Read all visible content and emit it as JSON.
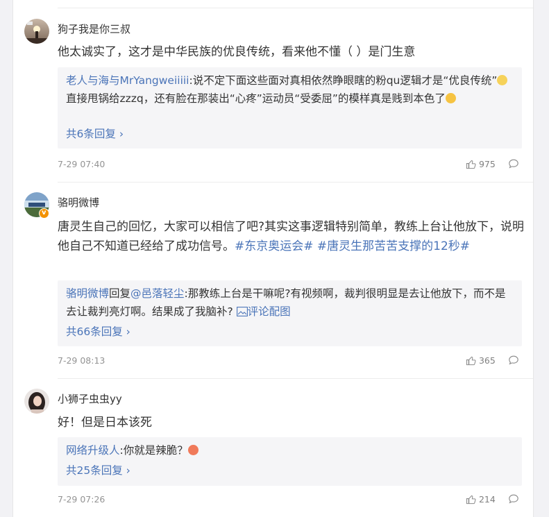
{
  "comments": [
    {
      "username": "狗子我是你三叔",
      "text": "他太诚实了，这才是中华民族的优良传统，看来他不懂（   ）是门生意",
      "reply": {
        "author": "老人与海与MrYangweiiiii",
        "text": ":说不定下面这些面对真相依然睁眼瞎的粉qu逻辑才是“优良传统”",
        "text2": "直接甩锅给zzzq，还有脸在那装出“心疼”运动员“受委屈”的模样真是贱到本色了"
      },
      "more_replies": "共6条回复",
      "time": "7-29 07:40",
      "likes": "975"
    },
    {
      "username": "骆明微博",
      "text": "唐灵生自己的回忆，大家可以相信了吧?其实这事逻辑特别简单，教练上台让他放下，说明他自己不知道已经给了成功信号。",
      "tags": [
        "#东京奥运会#",
        "#唐灵生那苦苦支撑的12秒#"
      ],
      "reply": {
        "author": "骆明微博",
        "reply_word": "回复",
        "target": "@邑落轻尘",
        "text": ":那教练上台是干嘛呢?有视频啊，裁判很明显是去让他放下，而不是去让裁判亮灯啊。结果成了我脑补?",
        "pic_link": "评论配图"
      },
      "more_replies": "共66条回复",
      "time": "7-29 08:13",
      "likes": "365"
    },
    {
      "username": "小狮子虫虫yy",
      "text": "好！但是日本该死",
      "reply": {
        "author": "网络升级人",
        "text": ":你就是辣脆？"
      },
      "more_replies": "共25条回复",
      "time": "7-29 07:26",
      "likes": "214"
    }
  ],
  "icons": {
    "like": "thumbs-up-icon",
    "comment": "comment-bubble-icon",
    "verified": "verified-badge-icon",
    "image": "image-icon"
  },
  "colors": {
    "link": "#4a74b8",
    "verified": "#f39200"
  }
}
